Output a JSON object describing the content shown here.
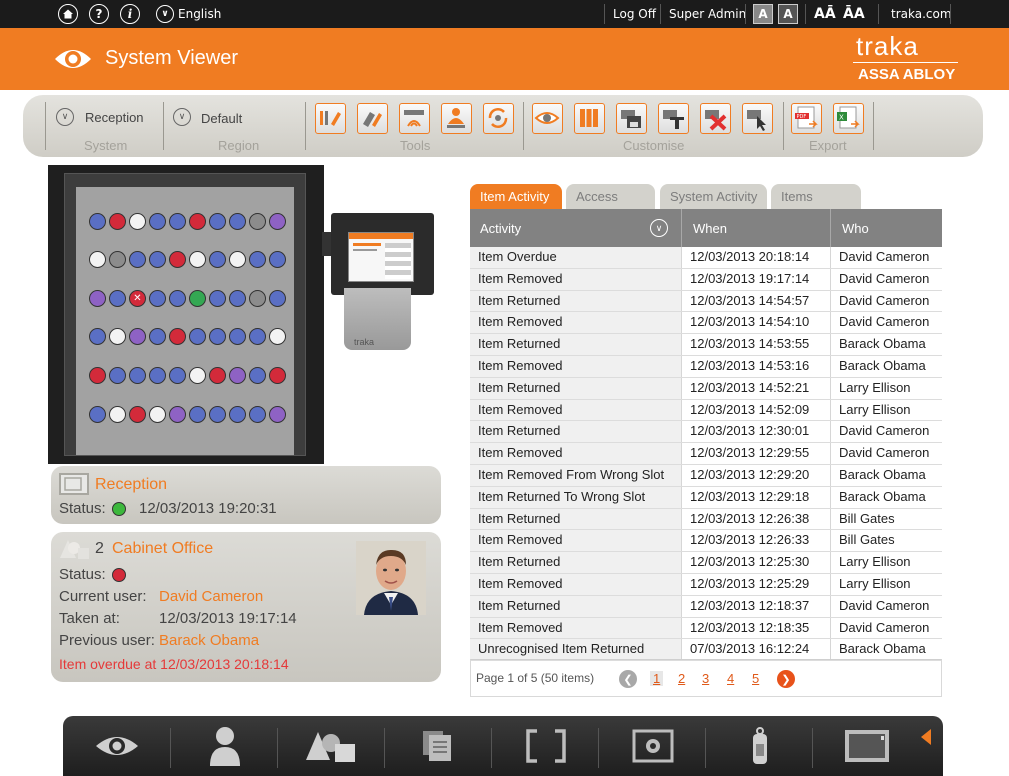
{
  "topbar": {
    "home_icon": "home-icon",
    "help_icon": "help-icon",
    "info_icon": "info-icon",
    "language_icon": "chevron-down-icon",
    "language": "English",
    "log_off": "Log Off",
    "user": "Super Admin",
    "font_small": "A",
    "font_large": "A",
    "text_smaller": "AĀ",
    "text_larger": "ĀA",
    "website": "traka.com"
  },
  "header": {
    "title": "System Viewer",
    "brand": "traka",
    "brand_sub": "ASSA ABLOY",
    "accent_color": "#f07c22"
  },
  "toolbar": {
    "system": {
      "value": "Reception",
      "label": "System"
    },
    "region": {
      "value": "Default",
      "label": "Region"
    },
    "tools_label": "Tools",
    "customise_label": "Customise",
    "export_label": "Export",
    "tools": [
      "edit-users-icon",
      "edit-items-icon",
      "reader-settings-icon",
      "alarm-icon",
      "sync-icon"
    ],
    "customise": [
      "view-icon",
      "columns-icon",
      "save-icon",
      "text-icon",
      "delete-icon",
      "select-icon"
    ],
    "export": [
      "pdf-export-icon",
      "excel-export-icon"
    ]
  },
  "cabinet": {
    "brand": "traka",
    "rows": [
      [
        "blue",
        "red",
        "white",
        "blue",
        "blue",
        "red",
        "blue",
        "blue",
        "grey",
        "purple"
      ],
      [
        "white",
        "grey",
        "blue",
        "blue",
        "red",
        "white",
        "blue",
        "white",
        "blue",
        "blue"
      ],
      [
        "purple",
        "blue",
        "xred",
        "blue",
        "blue",
        "green",
        "blue",
        "blue",
        "grey",
        "blue"
      ],
      [
        "blue",
        "white",
        "purple",
        "blue",
        "red",
        "blue",
        "blue",
        "blue",
        "blue",
        "white"
      ],
      [
        "red",
        "blue",
        "blue",
        "blue",
        "blue",
        "white",
        "red",
        "purple",
        "blue",
        "red"
      ],
      [
        "blue",
        "white",
        "red",
        "white",
        "purple",
        "blue",
        "blue",
        "blue",
        "blue",
        "purple"
      ]
    ]
  },
  "system_card": {
    "name": "Reception",
    "status_label": "Status:",
    "status_color": "#3db83d",
    "timestamp": "12/03/2013 19:20:31"
  },
  "item_card": {
    "number": "2",
    "name": "Cabinet Office",
    "status_label": "Status:",
    "status_color": "#d32a3a",
    "current_user_label": "Current user:",
    "current_user": "David Cameron",
    "taken_at_label": "Taken at:",
    "taken_at": "12/03/2013 19:17:14",
    "previous_user_label": "Previous user:",
    "previous_user": "Barack Obama",
    "alert": "Item overdue at 12/03/2013 20:18:14"
  },
  "tabs": [
    "Item Activity",
    "Access",
    "System Activity",
    "Items"
  ],
  "table": {
    "headers": [
      "Activity",
      "When",
      "Who"
    ],
    "rows": [
      [
        "Item Overdue",
        "12/03/2013 20:18:14",
        "David Cameron"
      ],
      [
        "Item Removed",
        "12/03/2013 19:17:14",
        "David Cameron"
      ],
      [
        "Item Returned",
        "12/03/2013 14:54:57",
        "David Cameron"
      ],
      [
        "Item Removed",
        "12/03/2013 14:54:10",
        "David Cameron"
      ],
      [
        "Item Returned",
        "12/03/2013 14:53:55",
        "Barack Obama"
      ],
      [
        "Item Removed",
        "12/03/2013 14:53:16",
        "Barack Obama"
      ],
      [
        "Item Returned",
        "12/03/2013 14:52:21",
        "Larry Ellison"
      ],
      [
        "Item Removed",
        "12/03/2013 14:52:09",
        "Larry Ellison"
      ],
      [
        "Item Returned",
        "12/03/2013 12:30:01",
        "David Cameron"
      ],
      [
        "Item Removed",
        "12/03/2013 12:29:55",
        "David Cameron"
      ],
      [
        "Item Removed From Wrong Slot",
        "12/03/2013 12:29:20",
        "Barack Obama"
      ],
      [
        "Item Returned To Wrong Slot",
        "12/03/2013 12:29:18",
        "Barack Obama"
      ],
      [
        "Item Returned",
        "12/03/2013 12:26:38",
        "Bill Gates"
      ],
      [
        "Item Removed",
        "12/03/2013 12:26:33",
        "Bill Gates"
      ],
      [
        "Item Returned",
        "12/03/2013 12:25:30",
        "Larry Ellison"
      ],
      [
        "Item Removed",
        "12/03/2013 12:25:29",
        "Larry Ellison"
      ],
      [
        "Item Returned",
        "12/03/2013 12:18:37",
        "David Cameron"
      ],
      [
        "Item Removed",
        "12/03/2013 12:18:35",
        "David Cameron"
      ],
      [
        "Unrecognised Item Returned",
        "07/03/2013 16:12:24",
        "Barack Obama"
      ]
    ]
  },
  "pager": {
    "summary": "Page 1 of 5 (50 items)",
    "pages": [
      "1",
      "2",
      "3",
      "4",
      "5"
    ],
    "current": "1"
  },
  "bottom_nav": [
    "eye-icon",
    "user-icon",
    "shapes-icon",
    "documents-icon",
    "brackets-icon",
    "settings-icon",
    "key-fob-icon",
    "cabinet-icon"
  ]
}
